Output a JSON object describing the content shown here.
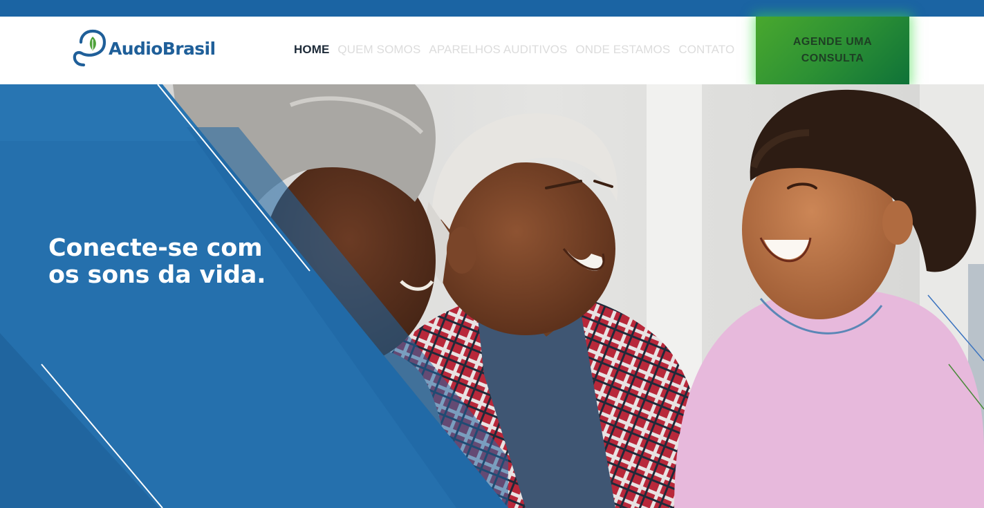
{
  "brand": {
    "name": "AudioBrasil",
    "colors": {
      "primary_blue": "#1b64a3",
      "panel_blue": "#2570ad",
      "cta_green": "#2d9134",
      "nav_inactive": "#dcdcdc",
      "nav_active": "#1d2a38",
      "leaf_green": "#4fa23a"
    }
  },
  "header": {
    "logo_icon": "ear-leaf-icon",
    "nav": [
      {
        "label": "HOME",
        "active": true
      },
      {
        "label": "QUEM SOMOS",
        "active": false
      },
      {
        "label": "APARELHOS AUDITIVOS",
        "active": false
      },
      {
        "label": "ONDE ESTAMOS",
        "active": false
      },
      {
        "label": "CONTATO",
        "active": false
      }
    ],
    "cta": {
      "label": "AGENDE UMA CONSULTA"
    }
  },
  "hero": {
    "headline": "Conecte-se com os sons da vida."
  }
}
